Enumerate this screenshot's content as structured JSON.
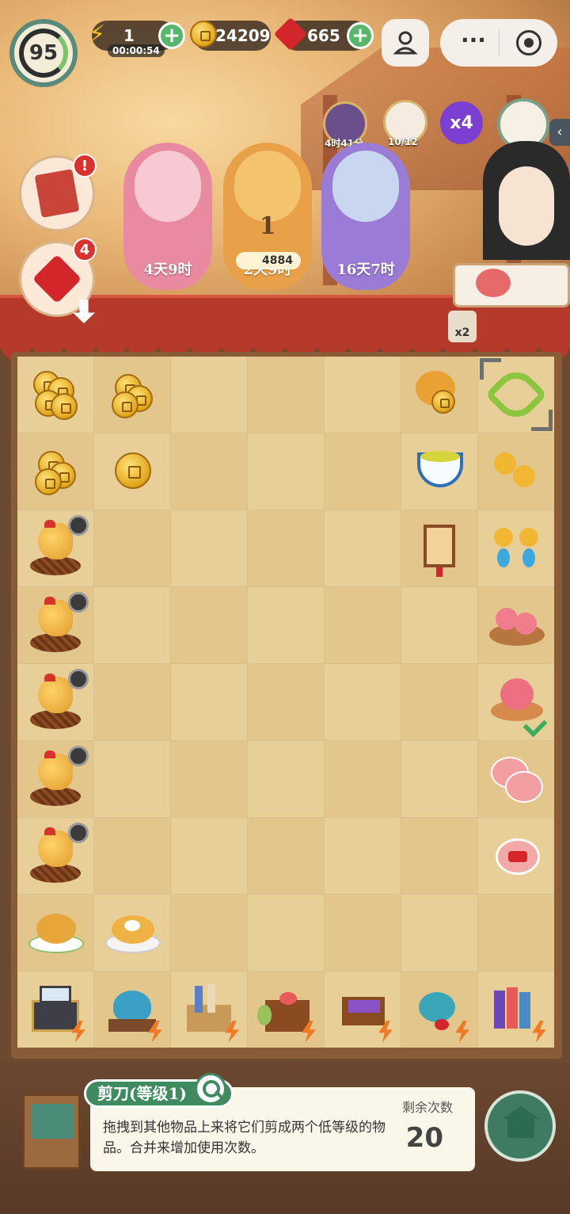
{
  "hud": {
    "level": "95",
    "energy": "1",
    "energy_timer": "00:00:54",
    "coins": "24209",
    "gems": "665"
  },
  "events": {
    "timer_label": "4时41分",
    "cat_progress": "10/12",
    "multiplier": "x4",
    "side_badge_count": "4",
    "alert_mark": "!",
    "order_multiplier": "x2"
  },
  "banners": [
    {
      "label": "4天9时",
      "color": "#e77f96"
    },
    {
      "label": "2天9时",
      "color": "#e8a148",
      "level": "1",
      "points": "4884"
    },
    {
      "label": "16天7时",
      "color": "#9a7bd6"
    }
  ],
  "board": {
    "rows": [
      [
        "coins-pile-3",
        "coins-pile-2",
        "",
        "",
        "",
        "coin-bag",
        "scissors"
      ],
      [
        "coins-pile-2",
        "coin-single",
        "",
        "",
        "",
        "tea-bowl",
        "hairpin-flower"
      ],
      [
        "hen-nest",
        "",
        "",
        "",
        "",
        "lantern",
        "earrings"
      ],
      [
        "hen-nest",
        "",
        "",
        "",
        "",
        "",
        "pastry-plate"
      ],
      [
        "hen-nest",
        "",
        "",
        "",
        "",
        "",
        "peach-pastry"
      ],
      [
        "hen-nest",
        "",
        "",
        "",
        "",
        "",
        "cat-cakes"
      ],
      [
        "hen-nest",
        "",
        "",
        "",
        "",
        "",
        "cat-cake"
      ],
      [
        "roast-chicken",
        "fried-rice",
        "",
        "",
        "",
        "",
        ""
      ],
      [
        "jewel-chest",
        "teapot-set",
        "scroll-basket",
        "food-crate",
        "loom",
        "tea-set",
        "book-stack"
      ]
    ]
  },
  "info": {
    "item_name": "剪刀(等级1)",
    "description": "拖拽到其他物品上来将它们剪成两个低等级的物品。合并来增加使用次数。",
    "remain_label": "剩余次数",
    "remain_value": "20"
  },
  "buttons": {
    "menu_dots": "···"
  },
  "colors": {
    "accent_green": "#58b66a",
    "awning_red": "#b63a2c",
    "tag_green": "#3f8a5e"
  }
}
